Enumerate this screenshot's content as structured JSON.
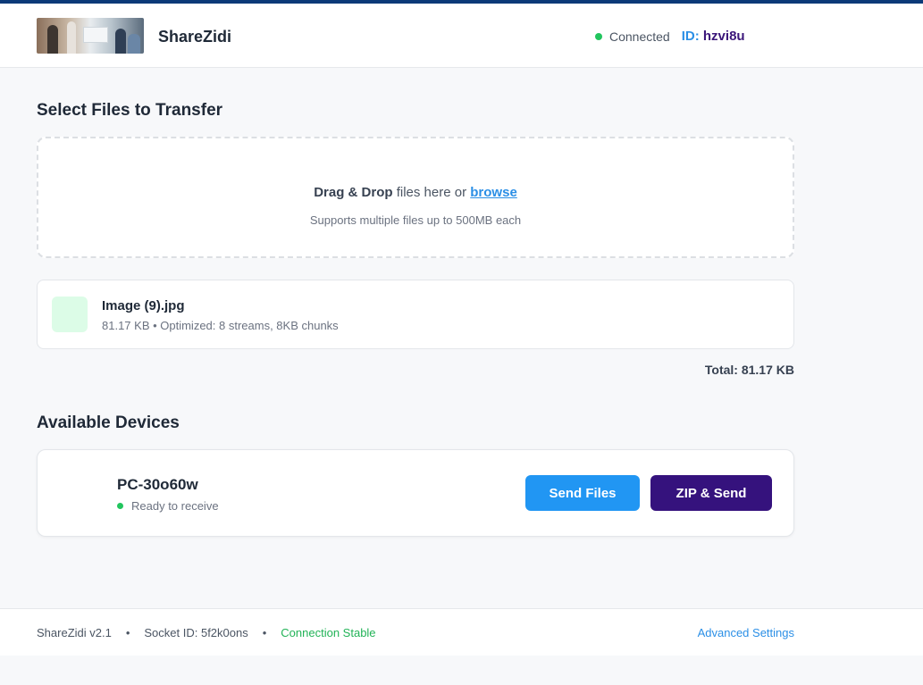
{
  "header": {
    "brand": "ShareZidi",
    "status": "Connected",
    "id_label": "ID:",
    "id_value": "hzvi8u",
    "status_color": "#22c55e"
  },
  "upload": {
    "title": "Select Files to Transfer",
    "drop_strong": "Drag & Drop",
    "drop_text": "files here or",
    "browse": "browse",
    "support": "Supports multiple files up to 500MB each"
  },
  "files": [
    {
      "name": "Image (9).jpg",
      "meta": "81.17 KB • Optimized: 8 streams, 8KB chunks",
      "icon": "image-file-icon"
    }
  ],
  "total": "Total: 81.17 KB",
  "devices": {
    "title": "Available Devices",
    "items": [
      {
        "name": "PC-30o60w",
        "status": "Ready to receive",
        "send_label": "Send Files",
        "zip_label": "ZIP & Send"
      }
    ]
  },
  "footer": {
    "version": "ShareZidi v2.1",
    "socket": "Socket ID: 5f2k0ons",
    "connection": "Connection Stable",
    "advanced": "Advanced Settings"
  },
  "colors": {
    "accent": "#2196f3",
    "brand_dark": "#35127d",
    "success": "#22c55e",
    "topbar": "#0b3a78"
  }
}
